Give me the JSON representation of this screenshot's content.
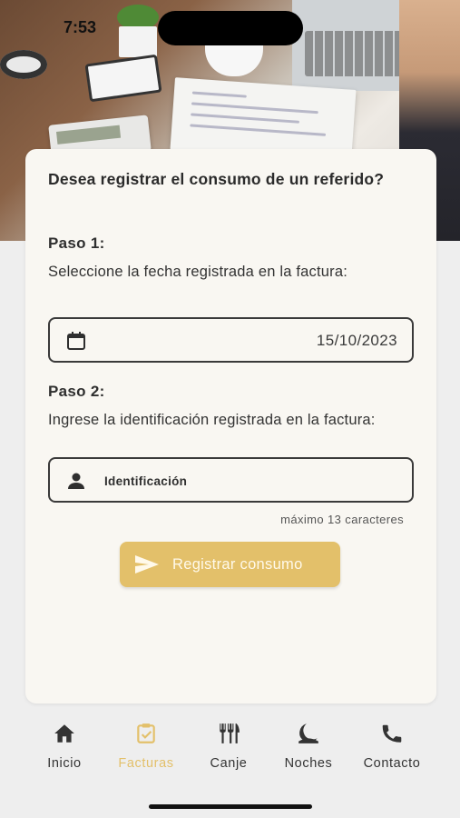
{
  "status_bar": {
    "time": "7:53"
  },
  "form": {
    "title": "Desea registrar el consumo de un referido?",
    "step1": {
      "label": "Paso 1:",
      "description": "Seleccione la fecha registrada en la factura:",
      "date_value": "15/10/2023",
      "icon": "calendar-icon"
    },
    "step2": {
      "label": "Paso 2:",
      "description": "Ingrese la identificación registrada en la factura:",
      "id_placeholder": "Identificación",
      "icon": "person-icon",
      "helper": "máximo 13 caracteres"
    },
    "submit": {
      "label": "Registrar consumo",
      "icon": "send-icon"
    }
  },
  "nav": {
    "items": [
      {
        "label": "Inicio",
        "icon": "home-icon",
        "active": false
      },
      {
        "label": "Facturas",
        "icon": "receipt-check-icon",
        "active": true
      },
      {
        "label": "Canje",
        "icon": "restaurant-icon",
        "active": false
      },
      {
        "label": "Noches",
        "icon": "night-icon",
        "active": false
      },
      {
        "label": "Contacto",
        "icon": "phone-icon",
        "active": false
      }
    ]
  },
  "colors": {
    "accent": "#e3c06a",
    "card_bg": "#f9f7f2",
    "page_bg": "#eeeeee",
    "text": "#2f2f2f"
  }
}
